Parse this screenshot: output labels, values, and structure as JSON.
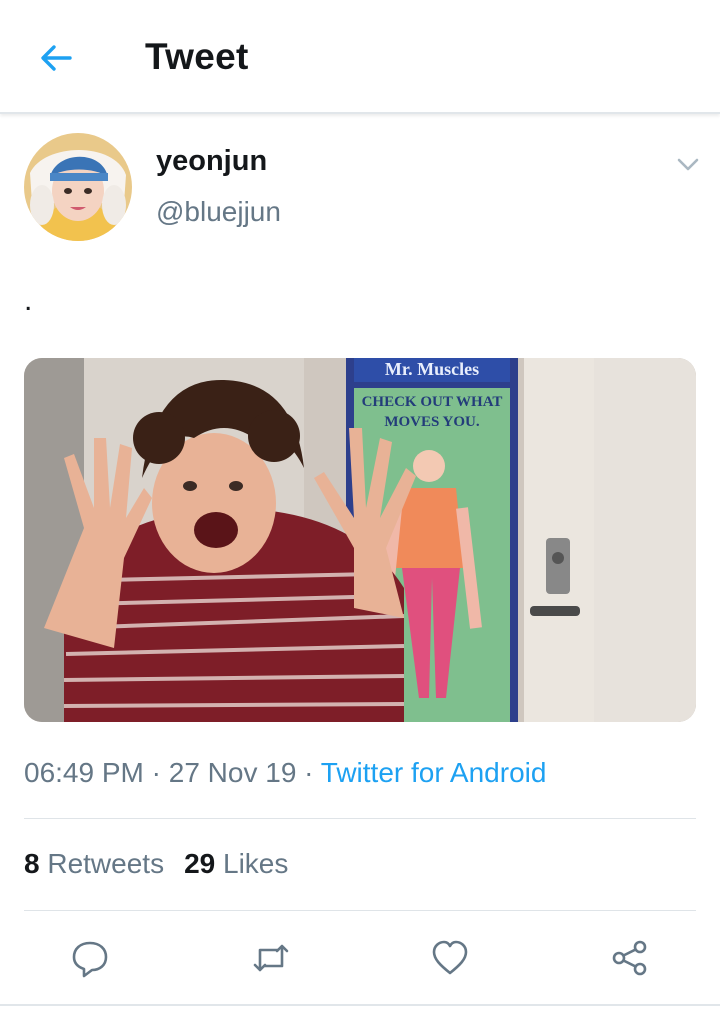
{
  "header": {
    "title": "Tweet",
    "back_icon": "arrow-left-icon"
  },
  "tweet": {
    "author": {
      "name": "yeonjun",
      "handle": "@bluejjun"
    },
    "text": ".",
    "media_alt": "",
    "meta": {
      "time": "06:49 PM",
      "sep1": " · ",
      "date": "27 Nov 19",
      "sep2": " · ",
      "source": "Twitter for Android"
    },
    "stats": {
      "retweets_count": "8",
      "retweets_label": "Retweets",
      "likes_count": "29",
      "likes_label": "Likes"
    },
    "media_poster": {
      "line1": "Mr. Muscles",
      "line2": "CHECK OUT WHAT",
      "line3": "MOVES YOU."
    }
  },
  "actions": [
    "reply-icon",
    "retweet-icon",
    "like-icon",
    "share-icon"
  ],
  "colors": {
    "accent": "#1da1f2",
    "secondary_text": "#657786",
    "primary_text": "#14171a",
    "divider": "#e1e6ea"
  }
}
